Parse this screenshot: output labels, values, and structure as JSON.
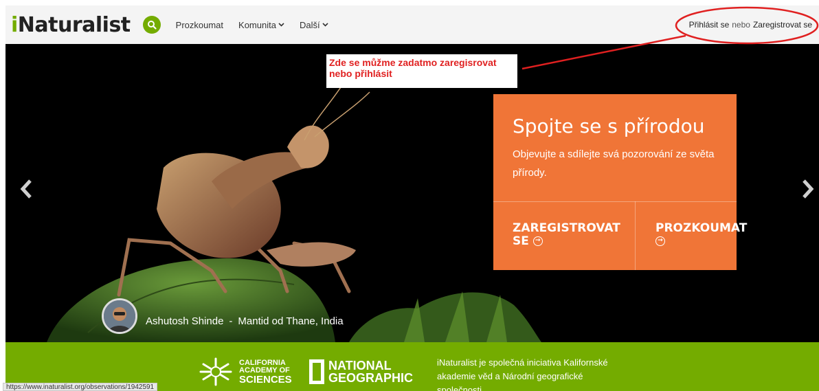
{
  "header": {
    "logo_i": "i",
    "logo_rest": "Naturalist",
    "nav": [
      {
        "label": "Prozkoumat",
        "has_dropdown": false
      },
      {
        "label": "Komunita",
        "has_dropdown": true
      },
      {
        "label": "Další",
        "has_dropdown": true
      }
    ],
    "sign_in": "Přihlásit se",
    "or": "nebo",
    "sign_up": "Zaregistrovat se"
  },
  "hero": {
    "promo": {
      "title": "Spojte se s přírodou",
      "text": "Objevujte a sdílejte svá pozorování ze světa přírody.",
      "signup_label": "ZAREGISTROVAT SE",
      "explore_label": "PROZKOUMAT"
    },
    "credit": {
      "author": "Ashutosh Shinde",
      "separator": "-",
      "caption": "Mantid od Thane, India"
    }
  },
  "annotation": {
    "text": "Zde se můžme zadatmo zaregisrovat nebo přihlásit",
    "color": "#e02020"
  },
  "footer": {
    "cas_line1": "CALIFORNIA",
    "cas_line2": "ACADEMY OF",
    "cas_line3": "SCIENCES",
    "ng_line1": "NATIONAL",
    "ng_line2": "GEOGRAPHIC",
    "about": "iNaturalist je společná iniciativa Kalifornské akademie věd a Národní geografické společnosti"
  },
  "status_bar_url": "https://www.inaturalist.org/observations/1942591",
  "colors": {
    "brand_green": "#74ac00",
    "promo_orange": "#f07537",
    "annotation_red": "#e02020"
  },
  "icons": {
    "search": "search-icon",
    "chevron": "chevron-down-icon",
    "prev": "chevron-left-icon",
    "next": "chevron-right-icon",
    "circle_arrow": "circle-arrow-right-icon"
  }
}
